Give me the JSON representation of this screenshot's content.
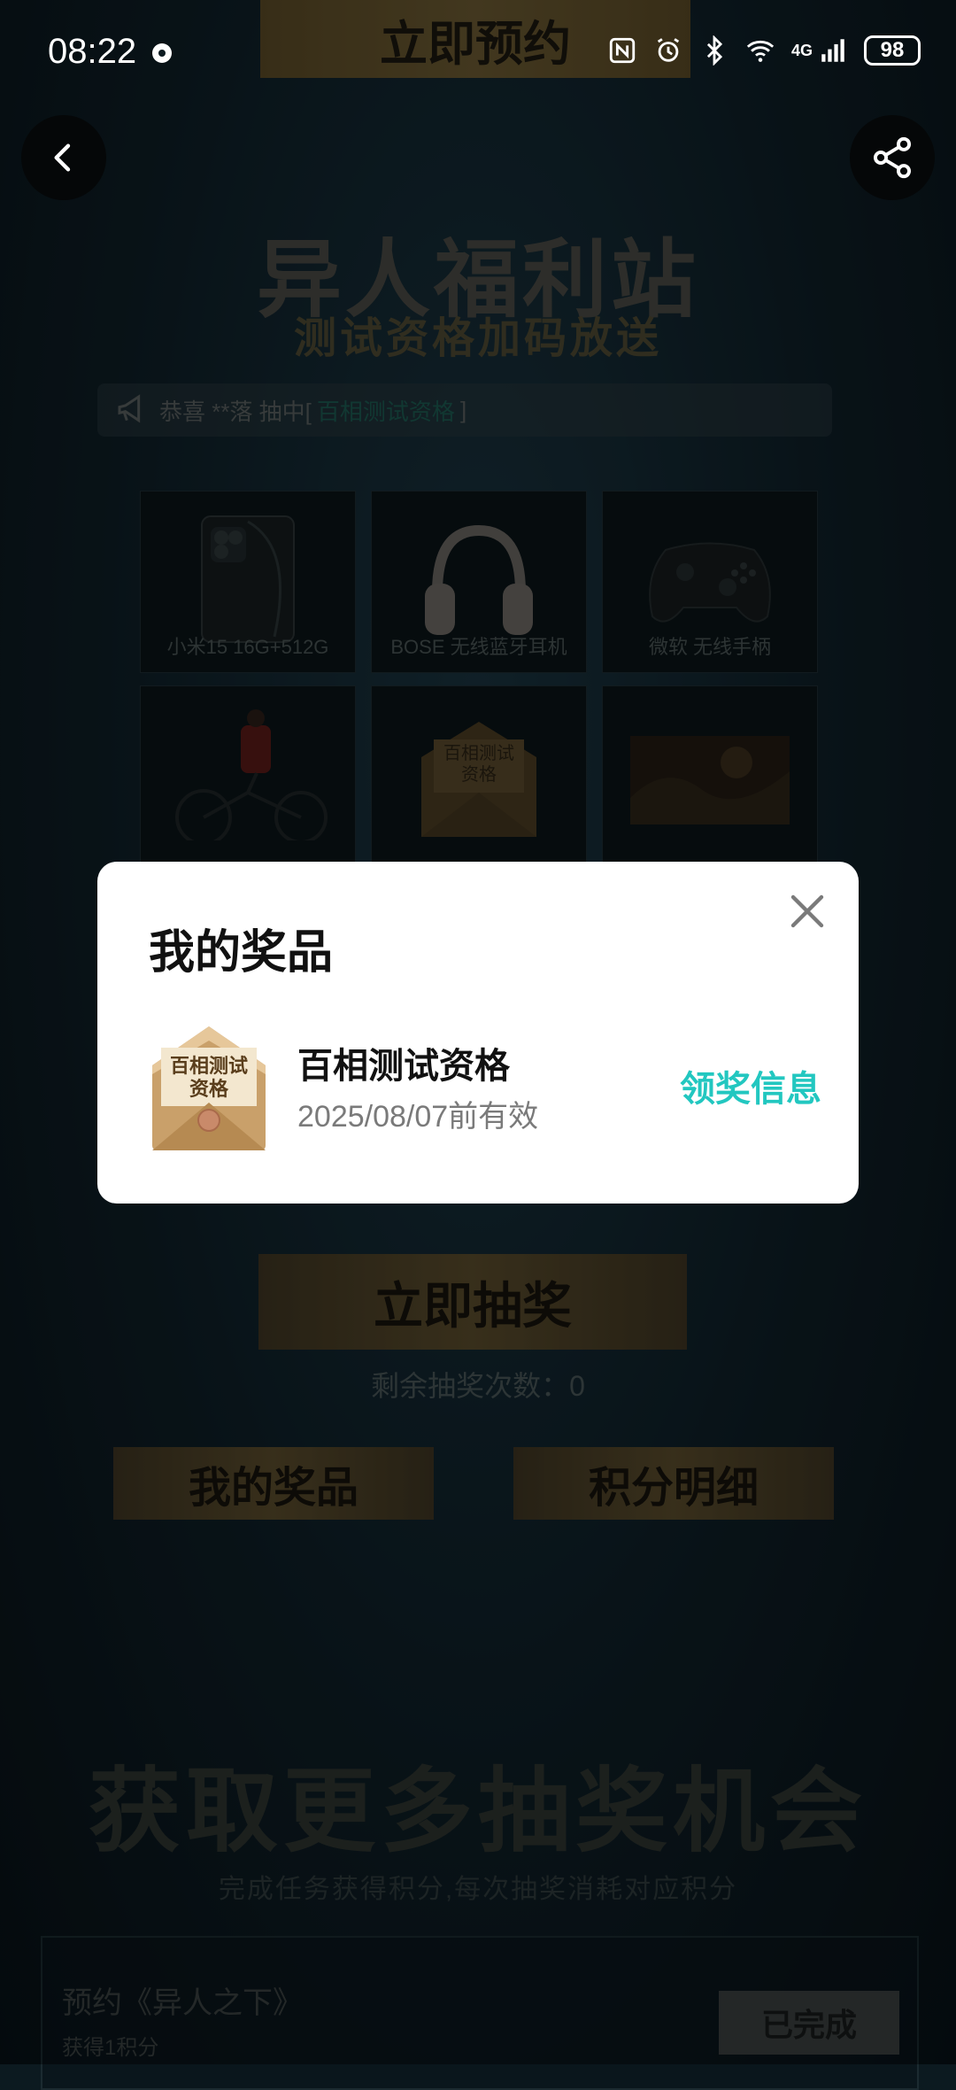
{
  "status": {
    "time": "08:22",
    "battery": "98",
    "network": "4G"
  },
  "header": {
    "reserve_label": "立即预约"
  },
  "hero": {
    "title": "异人福利站",
    "subtitle": "测试资格加码放送"
  },
  "ticker": {
    "prefix": "恭喜 **落 抽中[",
    "prize": "百相测试资格",
    "suffix": "]"
  },
  "prizes": [
    {
      "label": "小米15 16G+512G",
      "icon": "phone-icon"
    },
    {
      "label": "BOSE 无线蓝牙耳机",
      "icon": "headphones-icon"
    },
    {
      "label": "微软 无线手柄",
      "icon": "gamepad-icon"
    },
    {
      "label": "",
      "icon": "bicycle-figure-icon"
    },
    {
      "label": "",
      "icon": "envelope-icon",
      "art_text": "百相测试资格"
    },
    {
      "label": "",
      "icon": "scenery-icon"
    }
  ],
  "actions": {
    "draw_label": "立即抽奖",
    "draw_count_text": "剩余抽奖次数：0",
    "my_prizes_label": "我的奖品",
    "points_detail_label": "积分明细"
  },
  "tasks_section": {
    "title": "获取更多抽奖机会",
    "subtitle": "完成任务获得积分,每次抽奖消耗对应积分",
    "tasks": [
      {
        "title": "预约《异人之下》",
        "desc": "获得1积分",
        "button": "已完成"
      }
    ]
  },
  "modal": {
    "title": "我的奖品",
    "item": {
      "name": "百相测试资格",
      "thumb_text": "百相测试资格",
      "expiry": "2025/08/07前有效",
      "action": "领奖信息"
    }
  },
  "colors": {
    "accent": "#22c7c0",
    "gold": "#5a4c2c",
    "background": "#0e1e26"
  }
}
